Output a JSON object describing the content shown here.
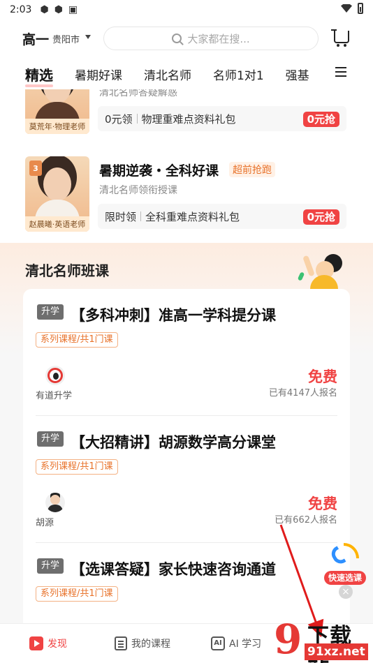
{
  "status_bar": {
    "time": "2:03"
  },
  "header": {
    "grade": "高一",
    "city": "贵阳市",
    "search_placeholder": "大家都在搜...",
    "tabs": [
      "精选",
      "暑期好课",
      "清北名师",
      "名师1对1",
      "强基"
    ]
  },
  "promos": [
    {
      "teacher_caption": "莫荒年·物理老师",
      "subtitle": "清北名师答疑解惑",
      "bar_text_1": "0元领",
      "bar_text_2": "物理重难点资料礼包",
      "button": "0元抢"
    },
    {
      "rank": "3",
      "teacher_caption": "赵晨曦·英语老师",
      "title": "暑期逆袭・全科好课",
      "tag": "超前抢跑",
      "subtitle": "清北名师领衔授课",
      "bar_text_1": "限时领",
      "bar_text_2": "全科重难点资料礼包",
      "button": "0元抢"
    }
  ],
  "class_section": {
    "title": "清北名师班课",
    "courses": [
      {
        "tag": "升学",
        "title": "【多科冲刺】准高一学科提分课",
        "series": "系列课程/共1门课",
        "teacher": "有道升学",
        "price": "免费",
        "enrolled": "已有4147人报名"
      },
      {
        "tag": "升学",
        "title": "【大招精讲】胡源数学高分课堂",
        "series": "系列课程/共1门课",
        "teacher": "胡源",
        "price": "免费",
        "enrolled": "已有662人报名"
      },
      {
        "tag": "升学",
        "title": "【选课答疑】家长快速咨询通道",
        "series": "系列课程/共1门课"
      }
    ]
  },
  "floating": {
    "quick_label": "快速选课",
    "close": "×"
  },
  "bottom_nav": {
    "items": [
      {
        "label": "发现",
        "icon": "play-icon"
      },
      {
        "label": "我的课程",
        "icon": "course-list-icon"
      },
      {
        "label": "AI 学习",
        "icon": "ai-icon"
      }
    ]
  },
  "watermark": {
    "glyph": "9",
    "text": "下载站",
    "url": "91xz.net"
  },
  "colors": {
    "accent": "#f04343",
    "orange": "#e8722a"
  }
}
